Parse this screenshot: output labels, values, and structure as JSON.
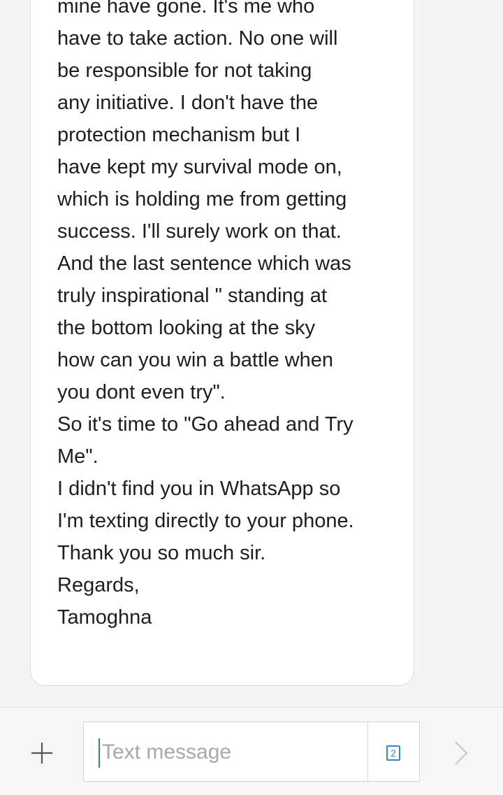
{
  "message": {
    "lines": [
      "mine have gone. It's me who",
      "have to take action. No one will",
      "be responsible for not taking",
      "any initiative. I don't have the",
      "protection mechanism but I",
      "have kept my survival mode on,",
      "which is holding me from getting",
      "success. I'll surely work on that.",
      "And the last sentence which was",
      "truly inspirational \" standing at",
      "the bottom looking at the sky",
      "how can you win a battle when",
      "you dont even try\".",
      "So it's time to \"Go ahead and Try",
      "Me\".",
      "I didn't find you in WhatsApp so",
      "I'm texting directly to your phone.",
      "Thank you so much sir.",
      "Regards,",
      "Tamoghna"
    ]
  },
  "composer": {
    "placeholder": "Text message",
    "value": "",
    "sim_label": "2",
    "add_icon": "plus-icon",
    "send_icon": "chevron-right-icon"
  },
  "colors": {
    "background": "#f4f4f4",
    "bubble": "#ffffff",
    "text": "#1e1e1e",
    "accent": "#3a86c8",
    "icon": "#555555",
    "send_icon": "#c8c8c8"
  }
}
